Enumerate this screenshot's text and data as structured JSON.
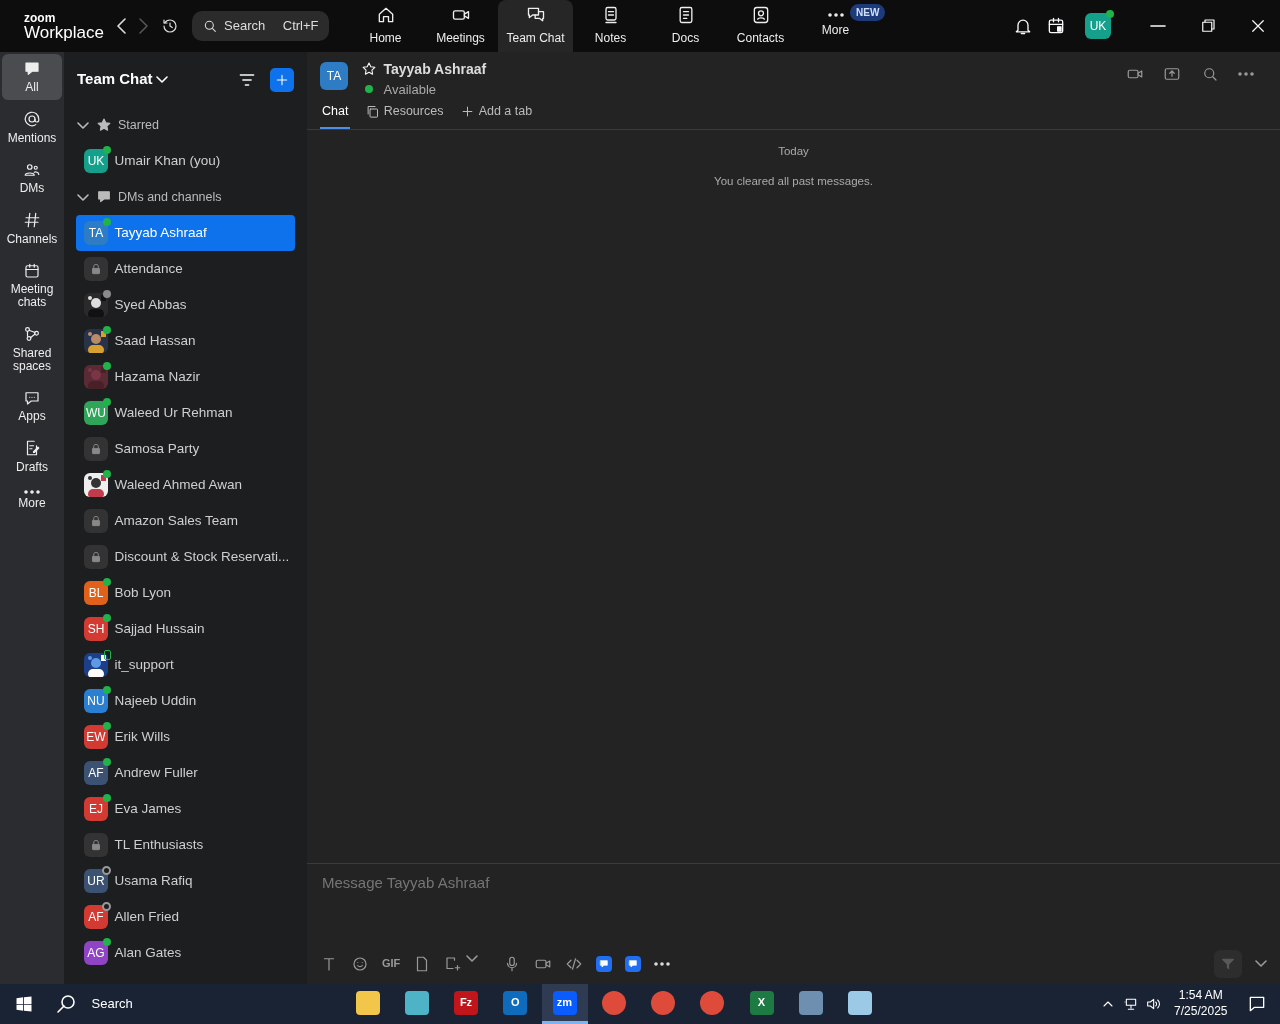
{
  "app": {
    "brand_small": "zoom",
    "brand": "Workplace"
  },
  "search": {
    "placeholder": "Search",
    "shortcut": "Ctrl+F"
  },
  "nav_tabs": [
    {
      "label": "Home",
      "selected": false
    },
    {
      "label": "Meetings",
      "selected": false
    },
    {
      "label": "Team Chat",
      "selected": true
    },
    {
      "label": "Notes",
      "selected": false
    },
    {
      "label": "Docs",
      "selected": false
    },
    {
      "label": "Contacts",
      "selected": false
    },
    {
      "label": "More",
      "selected": false,
      "badge": "NEW"
    }
  ],
  "account": {
    "initials": "UK",
    "status": {
      "kind": "dot",
      "color": "#1fb34a"
    }
  },
  "rail": [
    {
      "label": "All",
      "selected": true
    },
    {
      "label": "Mentions",
      "selected": false
    },
    {
      "label": "DMs",
      "selected": false
    },
    {
      "label": "Channels",
      "selected": false
    },
    {
      "label": "Meeting chats",
      "selected": false
    },
    {
      "label": "Shared spaces",
      "selected": false
    },
    {
      "label": "Apps",
      "selected": false
    },
    {
      "label": "Drafts",
      "selected": false
    },
    {
      "label": "More",
      "selected": false
    }
  ],
  "panel": {
    "title": "Team Chat"
  },
  "sections": [
    {
      "label": "Starred",
      "expanded": true,
      "items": [
        {
          "name": "Umair Khan (you)",
          "kind": "initials",
          "initials": "UK",
          "color": "#14a08a",
          "status": {
            "kind": "dot",
            "color": "#1fb34a"
          },
          "selected": false
        }
      ]
    },
    {
      "label": "DMs and channels",
      "expanded": true,
      "items": [
        {
          "name": "Tayyab Ashraaf",
          "kind": "initials",
          "initials": "TA",
          "color": "#2d7cc4",
          "status": {
            "kind": "dot",
            "color": "#1fb34a"
          },
          "selected": true
        },
        {
          "name": "Attendance",
          "kind": "channel",
          "selected": false
        },
        {
          "name": "Syed Abbas",
          "status": {
            "kind": "dot",
            "color": "#8a8a8a"
          },
          "selected": false
        },
        {
          "name": "Saad Hassan",
          "status": {
            "kind": "dot",
            "color": "#1fb34a"
          },
          "selected": false
        },
        {
          "name": "Hazama Nazir",
          "status": {
            "kind": "dot",
            "color": "#1fb34a"
          },
          "selected": false
        },
        {
          "name": "Waleed Ur Rehman",
          "kind": "initials",
          "initials": "WU",
          "color": "#2fa55a",
          "status": {
            "kind": "dot",
            "color": "#1fb34a"
          },
          "selected": false
        },
        {
          "name": "Samosa Party",
          "kind": "channel",
          "selected": false
        },
        {
          "name": "Waleed Ahmed Awan",
          "status": {
            "kind": "dot",
            "color": "#1fb34a"
          },
          "selected": false
        },
        {
          "name": "Amazon Sales Team",
          "kind": "channel",
          "selected": false
        },
        {
          "name": "Discount & Stock Reservati...",
          "kind": "channel",
          "selected": false
        },
        {
          "name": "Bob Lyon",
          "kind": "initials",
          "initials": "BL",
          "color": "#e0611a",
          "status": {
            "kind": "dot",
            "color": "#1fb34a"
          },
          "selected": false
        },
        {
          "name": "Sajjad Hussain",
          "kind": "initials",
          "initials": "SH",
          "color": "#d23a32",
          "status": {
            "kind": "dot",
            "color": "#1fb34a"
          },
          "selected": false
        },
        {
          "name": "it_support",
          "status": {
            "kind": "phone",
            "color": "#1fb34a"
          },
          "selected": false
        },
        {
          "name": "Najeeb Uddin",
          "kind": "initials",
          "initials": "NU",
          "color": "#2b7fd0",
          "status": {
            "kind": "dot",
            "color": "#1fb34a"
          },
          "selected": false
        },
        {
          "name": "Erik Wills",
          "kind": "initials",
          "initials": "EW",
          "color": "#d23a32",
          "status": {
            "kind": "dot",
            "color": "#1fb34a"
          },
          "selected": false
        },
        {
          "name": "Andrew Fuller",
          "kind": "initials",
          "initials": "AF",
          "color": "#3b5272",
          "status": {
            "kind": "dot",
            "color": "#1fb34a"
          },
          "selected": false
        },
        {
          "name": "Eva James",
          "kind": "initials",
          "initials": "EJ",
          "color": "#d23a32",
          "status": {
            "kind": "dot",
            "color": "#1fb34a"
          },
          "selected": false
        },
        {
          "name": "TL Enthusiasts",
          "kind": "channel",
          "selected": false
        },
        {
          "name": "Usama Rafiq",
          "kind": "initials",
          "initials": "UR",
          "color": "#3b5272",
          "status": {
            "kind": "ring",
            "color": "#9a9a9a"
          },
          "selected": false
        },
        {
          "name": "Allen Fried",
          "kind": "initials",
          "initials": "AF",
          "color": "#d23a32",
          "status": {
            "kind": "ring",
            "color": "#9a9a9a"
          },
          "selected": false
        },
        {
          "name": "Alan Gates",
          "kind": "initials",
          "initials": "AG",
          "color": "#8e44c4",
          "status": {
            "kind": "dot",
            "color": "#1fb34a"
          },
          "selected": false
        }
      ]
    }
  ],
  "chat": {
    "initials": "TA",
    "name": "Tayyab Ashraaf",
    "starred": false,
    "status": "Available",
    "status_dot": {
      "kind": "dot",
      "color": "#1fb34a"
    },
    "tabs": [
      {
        "label": "Chat",
        "selected": true
      },
      {
        "label": "Resources",
        "selected": false
      },
      {
        "label": "Add a tab",
        "selected": false
      }
    ],
    "day": "Today",
    "notice": "You cleared all past messages."
  },
  "composer": {
    "placeholder": "Message Tayyab Ashraaf",
    "gif": "GIF",
    "send_disabled": true
  },
  "taskbar": {
    "search": "Search",
    "time": "1:54 AM",
    "date": "7/25/2025",
    "apps": [
      {
        "color": "#f2c54b",
        "selected": false
      },
      {
        "color": "#4fb3c8",
        "selected": false
      },
      {
        "glyph": "Fz",
        "color": "#c0161b",
        "selected": false
      },
      {
        "glyph": "O",
        "color": "#0f6cbd",
        "selected": false
      },
      {
        "glyph": "zm",
        "color": "#0b5cff",
        "selected": true
      },
      {
        "color": "#de4b3a",
        "selected": false
      },
      {
        "color": "#de4b3a",
        "selected": false
      },
      {
        "color": "#de4b3a",
        "selected": false
      },
      {
        "glyph": "X",
        "color": "#1d7a43",
        "selected": false
      },
      {
        "color": "#6f8fb0",
        "selected": false
      },
      {
        "color": "#9cc9e6",
        "selected": false
      }
    ]
  }
}
